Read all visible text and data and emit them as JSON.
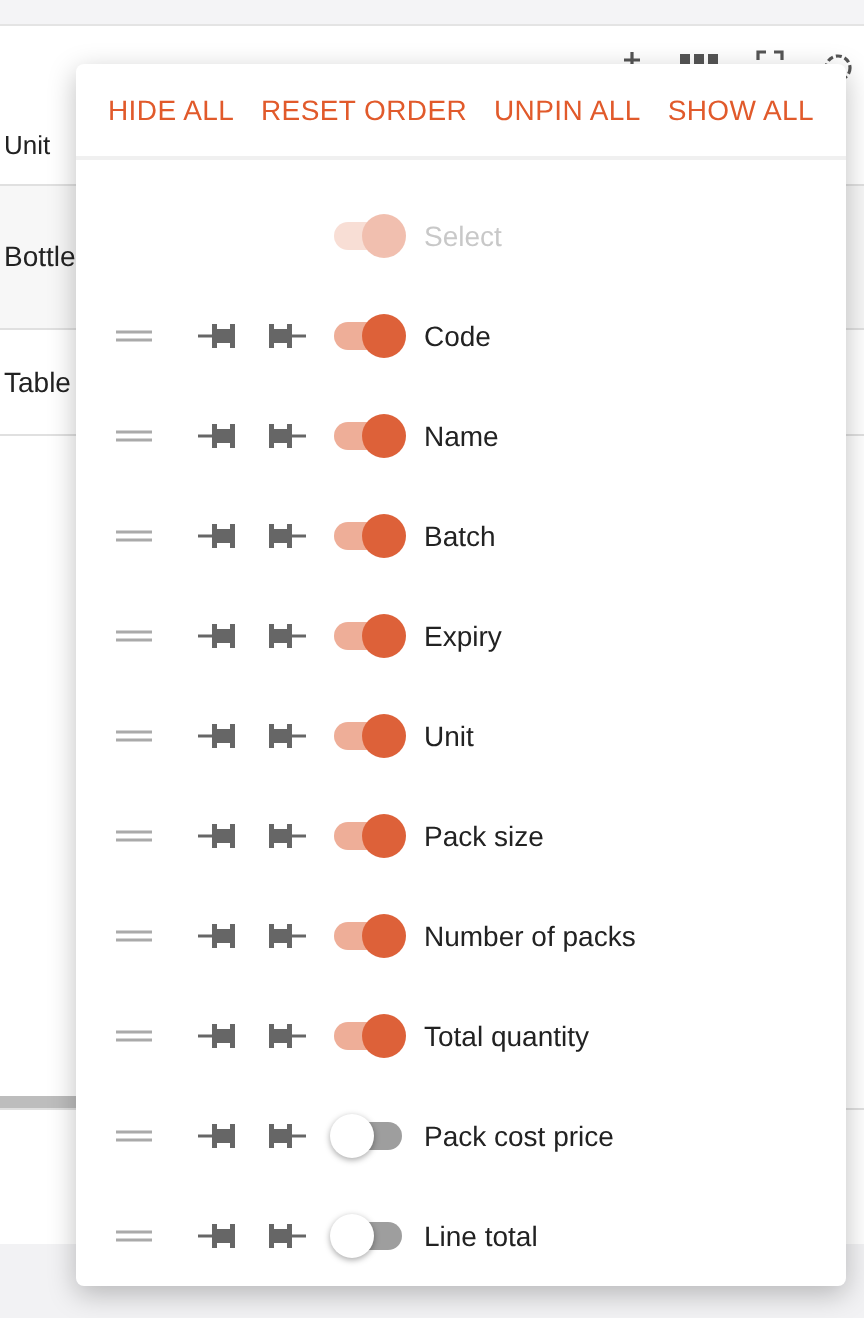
{
  "table": {
    "header": "Unit",
    "rows": [
      "Bottle",
      "Table"
    ]
  },
  "menu": {
    "actions": [
      "HIDE ALL",
      "RESET ORDER",
      "UNPIN ALL",
      "SHOW ALL"
    ],
    "columns": [
      {
        "label": "Select",
        "on": true,
        "disabled": true
      },
      {
        "label": "Code",
        "on": true,
        "disabled": false
      },
      {
        "label": "Name",
        "on": true,
        "disabled": false
      },
      {
        "label": "Batch",
        "on": true,
        "disabled": false
      },
      {
        "label": "Expiry",
        "on": true,
        "disabled": false
      },
      {
        "label": "Unit",
        "on": true,
        "disabled": false
      },
      {
        "label": "Pack size",
        "on": true,
        "disabled": false
      },
      {
        "label": "Number of packs",
        "on": true,
        "disabled": false
      },
      {
        "label": "Total quantity",
        "on": true,
        "disabled": false
      },
      {
        "label": "Pack cost price",
        "on": false,
        "disabled": false
      },
      {
        "label": "Line total",
        "on": false,
        "disabled": false
      }
    ]
  }
}
